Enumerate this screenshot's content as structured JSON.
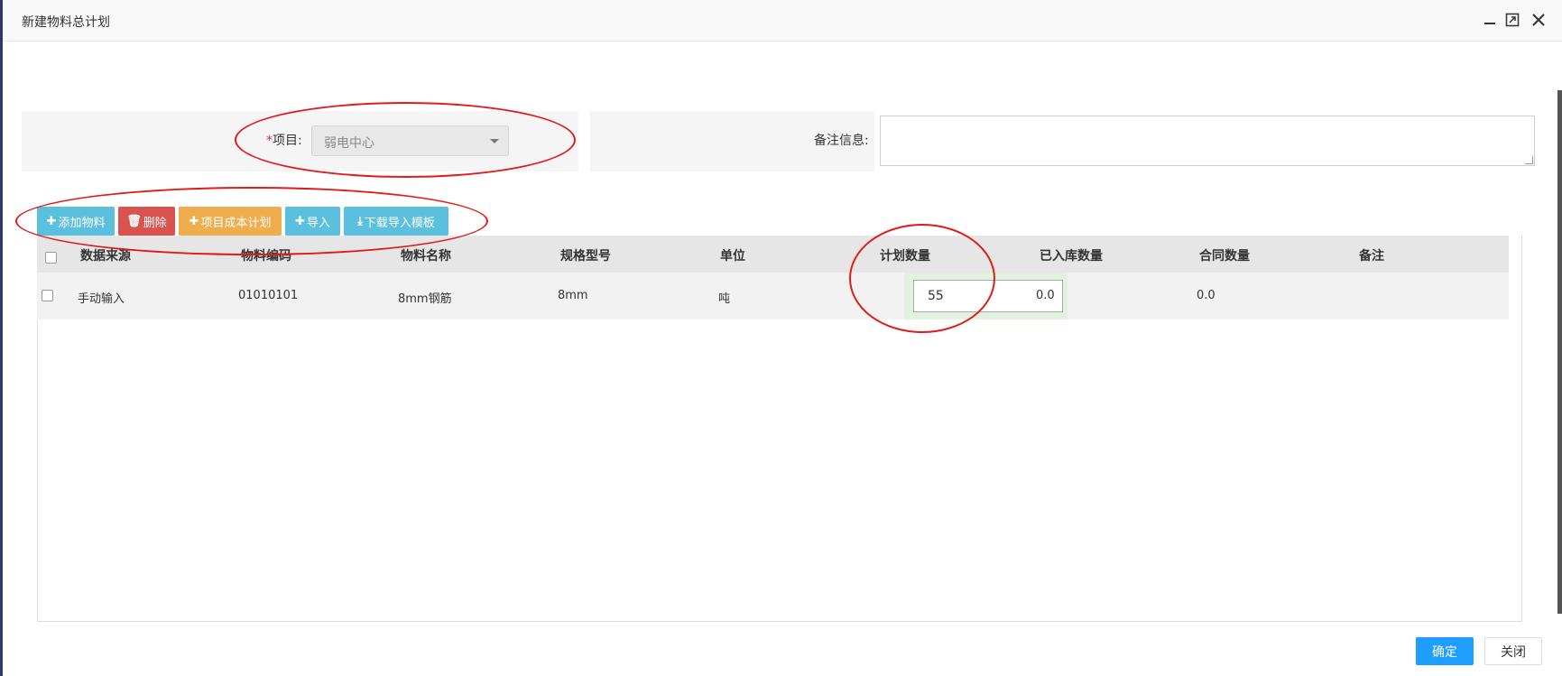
{
  "dialog": {
    "title": "新建物料总计划",
    "controls": [
      "minimize-icon",
      "maximize-icon",
      "close-icon"
    ]
  },
  "form": {
    "project_required_mark": "*",
    "project_label": "项目:",
    "project_value": "弱电中心",
    "remark_label": "备注信息:",
    "remark_value": ""
  },
  "toolbar": {
    "add_material": "添加物料",
    "delete": "删除",
    "project_cost_plan": "项目成本计划",
    "import": "导入",
    "download_template": "下载导入模板"
  },
  "table": {
    "columns": [
      "数据来源",
      "物料编码",
      "物料名称",
      "规格型号",
      "单位",
      "计划数量",
      "已入库数量",
      "合同数量",
      "备注"
    ],
    "rows": [
      {
        "source": "手动输入",
        "code": "01010101",
        "name": "8mm钢筋",
        "spec": "8mm",
        "unit": "吨",
        "planned_qty": "55",
        "received_qty": "0.0",
        "contract_qty": "0.0",
        "remark": ""
      }
    ]
  },
  "footer": {
    "confirm": "确定",
    "close": "关闭"
  },
  "colors": {
    "info": "#5bc0de",
    "danger": "#d9534f",
    "warning": "#f0ad4e",
    "primary": "#1e9fff",
    "annotation": "#e21a1a"
  }
}
